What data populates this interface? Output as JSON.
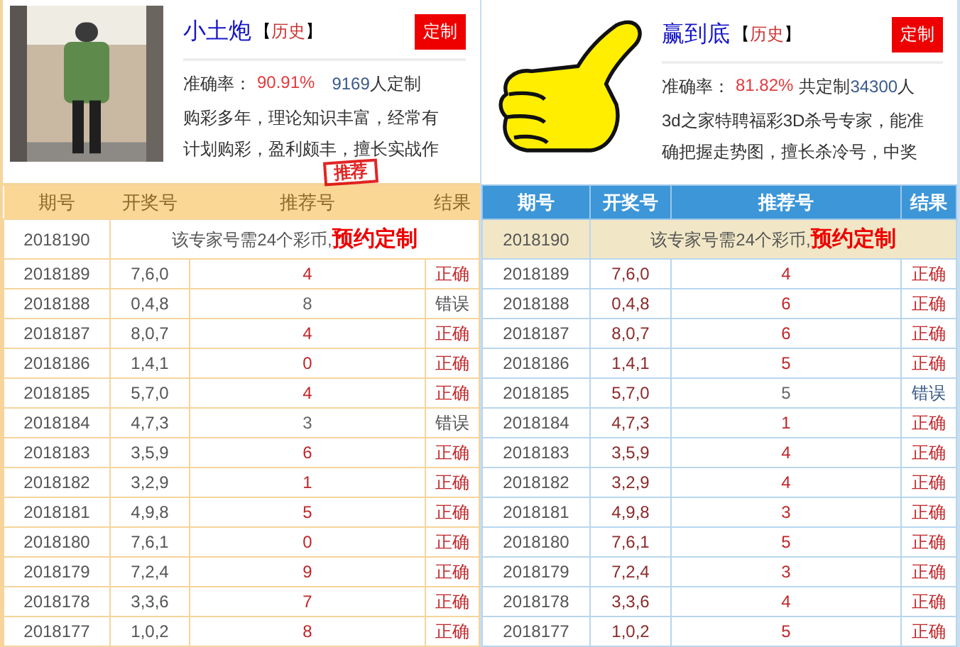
{
  "panels": [
    {
      "name": "小土炮",
      "bracket_open": "【",
      "history": "历史",
      "bracket_close": "】",
      "custom_button": "定制",
      "accuracy_label": "准确率：",
      "accuracy": "90.91%",
      "count": "9169",
      "count_suffix": "人定制",
      "bio_lines": [
        "购彩多年，理论知识丰富，经常有",
        "计划购彩，盈利颇丰，擅长实战作"
      ],
      "stamp": "推荐",
      "columns": [
        "期号",
        "开奖号",
        "推荐号",
        "结果"
      ],
      "pending": {
        "period": "2018190",
        "notice": "该专家号需24个彩币,",
        "link": "预约定制"
      },
      "rows": [
        {
          "period": "2018189",
          "draw": "7,6,0",
          "pick": "4",
          "result": "正确",
          "correct": true
        },
        {
          "period": "2018188",
          "draw": "0,4,8",
          "pick": "8",
          "result": "错误",
          "correct": false
        },
        {
          "period": "2018187",
          "draw": "8,0,7",
          "pick": "4",
          "result": "正确",
          "correct": true
        },
        {
          "period": "2018186",
          "draw": "1,4,1",
          "pick": "0",
          "result": "正确",
          "correct": true
        },
        {
          "period": "2018185",
          "draw": "5,7,0",
          "pick": "4",
          "result": "正确",
          "correct": true
        },
        {
          "period": "2018184",
          "draw": "4,7,3",
          "pick": "3",
          "result": "错误",
          "correct": false
        },
        {
          "period": "2018183",
          "draw": "3,5,9",
          "pick": "6",
          "result": "正确",
          "correct": true
        },
        {
          "period": "2018182",
          "draw": "3,2,9",
          "pick": "1",
          "result": "正确",
          "correct": true
        },
        {
          "period": "2018181",
          "draw": "4,9,8",
          "pick": "5",
          "result": "正确",
          "correct": true
        },
        {
          "period": "2018180",
          "draw": "7,6,1",
          "pick": "0",
          "result": "正确",
          "correct": true
        },
        {
          "period": "2018179",
          "draw": "7,2,4",
          "pick": "9",
          "result": "正确",
          "correct": true
        },
        {
          "period": "2018178",
          "draw": "3,3,6",
          "pick": "7",
          "result": "正确",
          "correct": true
        },
        {
          "period": "2018177",
          "draw": "1,0,2",
          "pick": "8",
          "result": "正确",
          "correct": true
        }
      ]
    },
    {
      "kind": "cartoon",
      "name": "赢到底",
      "bracket_open": "【",
      "history": "历史",
      "bracket_close": "】",
      "custom_button": "定制",
      "accuracy_label": "准确率：",
      "accuracy": "81.82%",
      "count_prefix": "共定制",
      "count": "34300",
      "count_suffix": "人",
      "bio_lines": [
        "3d之家特聘福彩3D杀号专家，能准",
        "确把握走势图，擅长杀冷号，中奖"
      ],
      "columns": [
        "期号",
        "开奖号",
        "推荐号",
        "结果"
      ],
      "pending": {
        "period": "2018190",
        "notice": "该专家号需24个彩币,",
        "link": "预约定制"
      },
      "rows": [
        {
          "period": "2018189",
          "draw": "7,6,0",
          "pick": "4",
          "result": "正确",
          "correct": true
        },
        {
          "period": "2018188",
          "draw": "0,4,8",
          "pick": "6",
          "result": "正确",
          "correct": true
        },
        {
          "period": "2018187",
          "draw": "8,0,7",
          "pick": "6",
          "result": "正确",
          "correct": true
        },
        {
          "period": "2018186",
          "draw": "1,4,1",
          "pick": "5",
          "result": "正确",
          "correct": true
        },
        {
          "period": "2018185",
          "draw": "5,7,0",
          "pick": "5",
          "result": "错误",
          "correct": false
        },
        {
          "period": "2018184",
          "draw": "4,7,3",
          "pick": "1",
          "result": "正确",
          "correct": true
        },
        {
          "period": "2018183",
          "draw": "3,5,9",
          "pick": "4",
          "result": "正确",
          "correct": true
        },
        {
          "period": "2018182",
          "draw": "3,2,9",
          "pick": "4",
          "result": "正确",
          "correct": true
        },
        {
          "period": "2018181",
          "draw": "4,9,8",
          "pick": "3",
          "result": "正确",
          "correct": true
        },
        {
          "period": "2018180",
          "draw": "7,6,1",
          "pick": "5",
          "result": "正确",
          "correct": true
        },
        {
          "period": "2018179",
          "draw": "7,2,4",
          "pick": "3",
          "result": "正确",
          "correct": true
        },
        {
          "period": "2018178",
          "draw": "3,3,6",
          "pick": "4",
          "result": "正确",
          "correct": true
        },
        {
          "period": "2018177",
          "draw": "1,0,2",
          "pick": "5",
          "result": "正确",
          "correct": true
        }
      ]
    }
  ]
}
